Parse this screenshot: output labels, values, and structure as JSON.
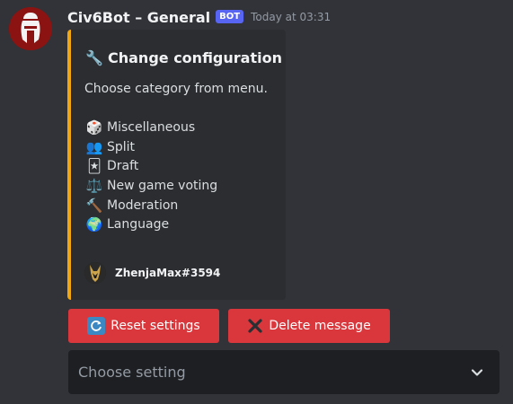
{
  "message": {
    "author": "Civ6Bot – General",
    "badge": "BOT",
    "timestamp": "Today at 03:31"
  },
  "embed": {
    "accent_color": "#f1a70f",
    "title_emoji": "🔧",
    "title": "Change configuration",
    "description": "Choose category from menu.",
    "categories": [
      {
        "emoji": "🎲",
        "label": "Miscellaneous"
      },
      {
        "emoji": "👥",
        "label": "Split"
      },
      {
        "emoji": "🃏",
        "label": "Draft"
      },
      {
        "emoji": "⚖️",
        "label": "New game voting"
      },
      {
        "emoji": "🔨",
        "label": "Moderation"
      },
      {
        "emoji": "🌍",
        "label": "Language"
      }
    ],
    "footer_user": "ZhenjaMax#3594"
  },
  "buttons": {
    "reset": {
      "emoji": "🔄",
      "label": "Reset settings"
    },
    "delete": {
      "emoji": "✖",
      "label": "Delete message"
    }
  },
  "select": {
    "placeholder": "Choose setting"
  },
  "colors": {
    "danger_button": "#da373c",
    "bot_badge": "#5865f2",
    "background": "#313338"
  }
}
